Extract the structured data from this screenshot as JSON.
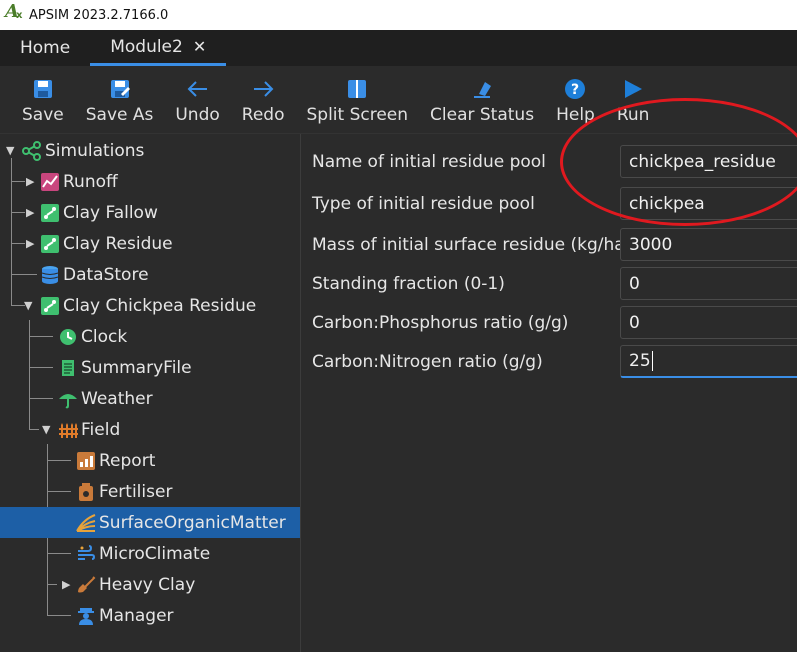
{
  "app": {
    "title": "APSIM 2023.2.7166.0"
  },
  "tabs": [
    {
      "label": "Home"
    },
    {
      "label": "Module2",
      "close": "✕"
    }
  ],
  "toolbar": {
    "save": "Save",
    "save_as": "Save As",
    "undo": "Undo",
    "redo": "Redo",
    "split_screen": "Split Screen",
    "clear_status": "Clear Status",
    "help": "Help",
    "run": "Run"
  },
  "tree": {
    "simulations": "Simulations",
    "runoff": "Runoff",
    "clay_fallow": "Clay Fallow",
    "clay_residue": "Clay Residue",
    "datastore": "DataStore",
    "clay_chickpea_residue": "Clay Chickpea Residue",
    "clock": "Clock",
    "summary_file": "SummaryFile",
    "weather": "Weather",
    "field": "Field",
    "report": "Report",
    "fertiliser": "Fertiliser",
    "surface_organic_matter": "SurfaceOrganicMatter",
    "micro_climate": "MicroClimate",
    "heavy_clay": "Heavy Clay",
    "manager": "Manager"
  },
  "properties": [
    {
      "label": "Name of initial residue pool",
      "value": "chickpea_residue"
    },
    {
      "label": "Type of initial residue pool",
      "value": "chickpea"
    },
    {
      "label": "Mass of initial surface residue (kg/ha)",
      "value": "3000"
    },
    {
      "label": "Standing fraction (0-1)",
      "value": "0"
    },
    {
      "label": "Carbon:Phosphorus ratio (g/g)",
      "value": "0"
    },
    {
      "label": "Carbon:Nitrogen ratio (g/g)",
      "value": "25"
    }
  ],
  "colors": {
    "accent": "#3a8ee6",
    "selection": "#1d5fa6",
    "annotation": "#e0191f"
  }
}
